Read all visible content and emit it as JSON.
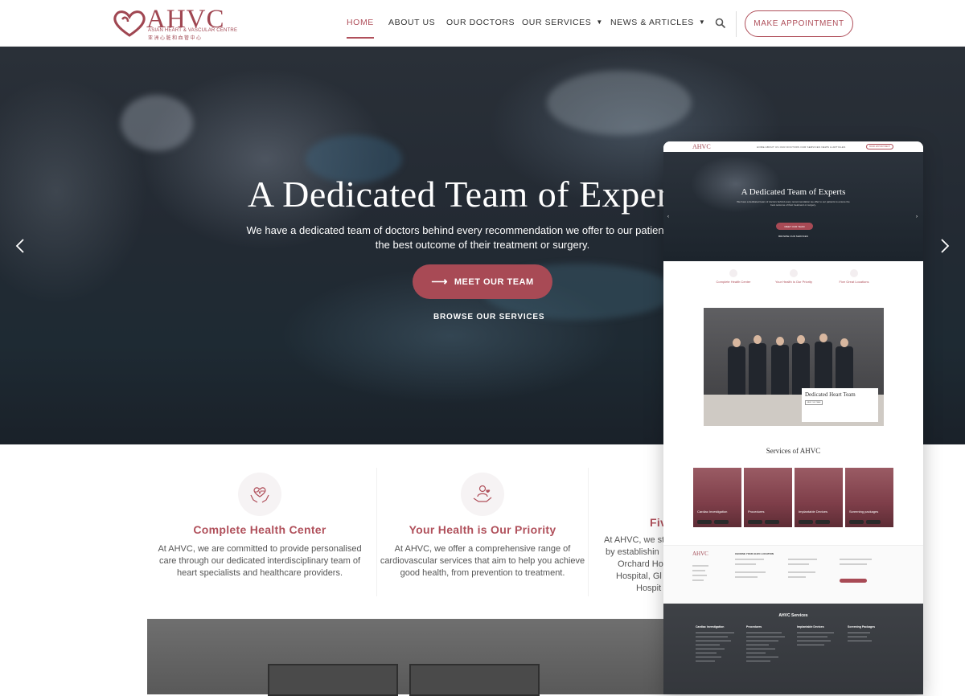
{
  "brand": {
    "logo_text": "AHVC",
    "logo_subtitle": "ASIAN HEART & VASCULAR CENTRE",
    "logo_chinese": "亚洲心脏和血管中心",
    "accent_color": "#b0505b"
  },
  "nav": {
    "items": [
      {
        "label": "HOME",
        "active": true
      },
      {
        "label": "ABOUT US",
        "active": false
      },
      {
        "label": "OUR DOCTORS",
        "active": false
      },
      {
        "label": "OUR SERVICES",
        "active": false,
        "dropdown": true
      },
      {
        "label": "NEWS & ARTICLES",
        "active": false,
        "dropdown": true
      }
    ],
    "search_icon": "search-icon",
    "cta_label": "MAKE APPOINTMENT"
  },
  "hero": {
    "title": "A Dedicated Team of Experts",
    "description": "We have a dedicated team of doctors behind every recommendation we offer to our patients to ensure the best outcome of their treatment or surgery.",
    "primary_button": "MEET OUR TEAM",
    "secondary_link": "BROWSE OUR SERVICES"
  },
  "features": [
    {
      "icon": "heart-hands-icon",
      "title": "Complete Health Center",
      "description": "At AHVC, we are committed to provide personalised care through our dedicated interdisciplinary team of heart specialists and healthcare providers."
    },
    {
      "icon": "hand-heart-person-icon",
      "title": "Your Health is Our Priority",
      "description": "At AHVC, we offer a comprehensive range of cardiovascular services that aim to help you achieve good health, from prevention to treatment."
    },
    {
      "icon": "location-icon",
      "title": "Fiv",
      "description_lines": [
        "At AHVC, we st",
        "by establishin",
        "Orchard Ho",
        "Hospital, Gl",
        "Hospit"
      ]
    }
  ],
  "mockup": {
    "header_logo": "AHVC",
    "nav_text": "HOME  ABOUT US  OUR DOCTORS  OUR SERVICES  NEWS & ARTICLES",
    "header_cta": "BOOK APPOINTMENT",
    "hero_title": "A Dedicated Team of Experts",
    "hero_button": "MEET OUR TEAM",
    "hero_link": "BROWSE OUR SERVICES",
    "features": [
      "Complete Health Center",
      "Your Health is Our Priority",
      "Five Great Locations"
    ],
    "team_card_title": "Dedicated Heart Team",
    "team_card_button": "MEET OUR TEAM",
    "services_title": "Services of AHVC",
    "services": [
      "Cardiac Investigation",
      "Procedures",
      "Implantable Devices",
      "Screening packages"
    ],
    "footer_logo": "AHVC",
    "footer_choose": "CHOOSE YOUR AHVC LOCATION",
    "footer_services_title": "AHVC Services",
    "footer_columns": [
      "Cardiac Investigation",
      "Procedures",
      "Implantable Devices",
      "Screening Packages"
    ]
  }
}
